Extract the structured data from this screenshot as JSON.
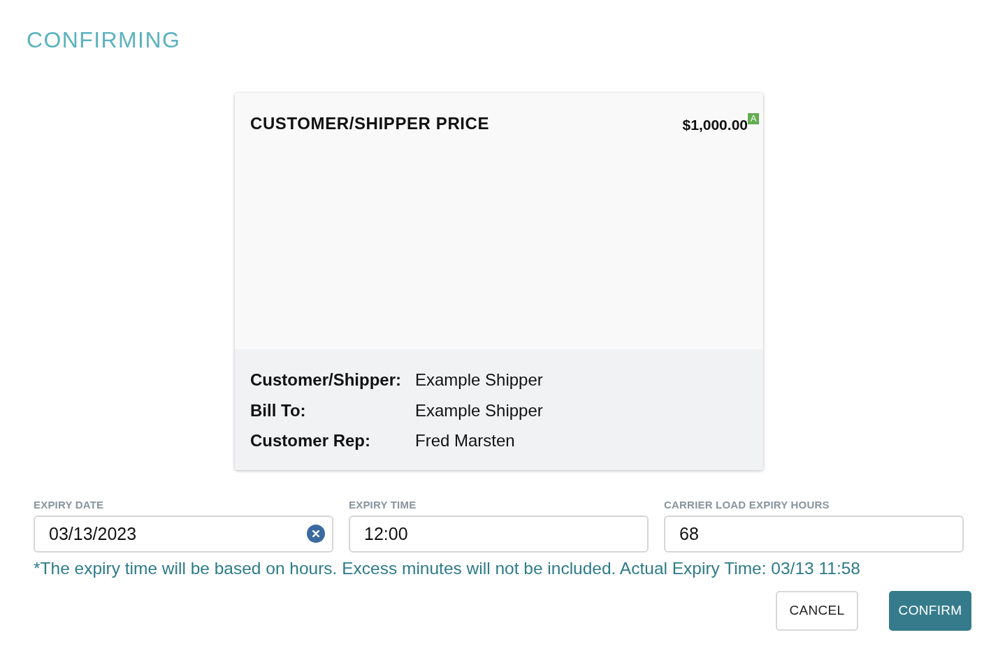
{
  "dialog": {
    "title": "CONFIRMING"
  },
  "price_card": {
    "title": "CUSTOMER/SHIPPER PRICE",
    "amount": "$1,000.00",
    "badge": "A",
    "details": [
      {
        "label": "Customer/Shipper:",
        "value": "Example Shipper"
      },
      {
        "label": "Bill To:",
        "value": "Example Shipper"
      },
      {
        "label": "Customer Rep:",
        "value": "Fred Marsten"
      }
    ]
  },
  "fields": [
    {
      "label": "EXPIRY DATE",
      "value": "03/13/2023",
      "clearable": true
    },
    {
      "label": "EXPIRY TIME",
      "value": "12:00",
      "clearable": false
    },
    {
      "label": "CARRIER LOAD EXPIRY HOURS",
      "value": "68",
      "clearable": false
    }
  ],
  "note": "*The expiry time will be based on hours. Excess minutes will not be included. Actual Expiry Time: 03/13 11:58",
  "buttons": [
    {
      "label": "CANCEL",
      "kind": "secondary"
    },
    {
      "label": "CONFIRM",
      "kind": "primary"
    }
  ]
}
